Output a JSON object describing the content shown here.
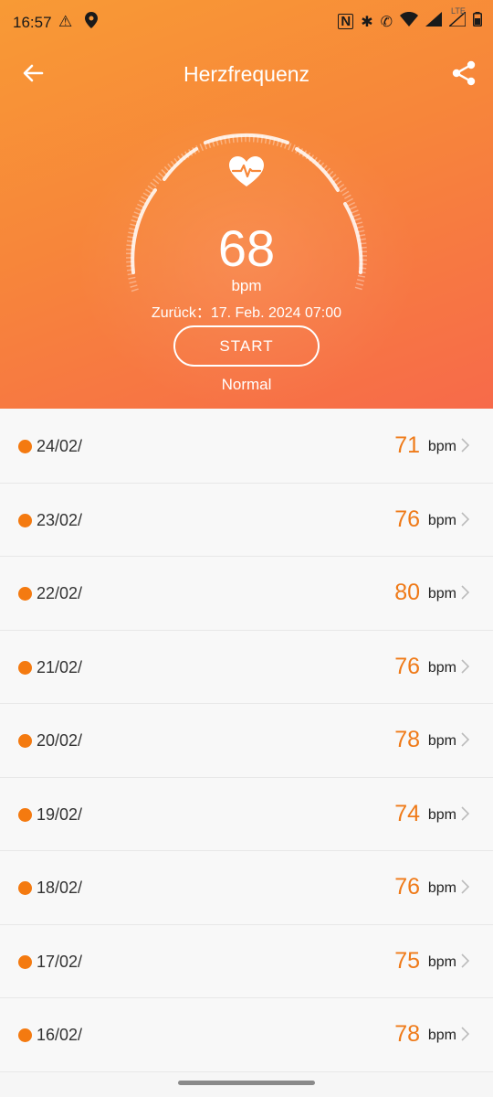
{
  "status_bar": {
    "time": "16:57",
    "network_label": "LTE"
  },
  "app_bar": {
    "title": "Herzfrequenz"
  },
  "summary": {
    "bpm_value": "68",
    "bpm_unit": "bpm",
    "last_measure": "Zurück：17. Feb. 2024 07:00",
    "start_label": "START",
    "status": "Normal"
  },
  "history": [
    {
      "date": "24/02/",
      "value": "71",
      "unit": "bpm"
    },
    {
      "date": "23/02/",
      "value": "76",
      "unit": "bpm"
    },
    {
      "date": "22/02/",
      "value": "80",
      "unit": "bpm"
    },
    {
      "date": "21/02/",
      "value": "76",
      "unit": "bpm"
    },
    {
      "date": "20/02/",
      "value": "78",
      "unit": "bpm"
    },
    {
      "date": "19/02/",
      "value": "74",
      "unit": "bpm"
    },
    {
      "date": "18/02/",
      "value": "76",
      "unit": "bpm"
    },
    {
      "date": "17/02/",
      "value": "75",
      "unit": "bpm"
    },
    {
      "date": "16/02/",
      "value": "78",
      "unit": "bpm"
    }
  ],
  "colors": {
    "accent": "#ef7a18",
    "dot": "#f47a10",
    "header_top": "#f89a35",
    "header_bottom": "#f76a4a"
  }
}
